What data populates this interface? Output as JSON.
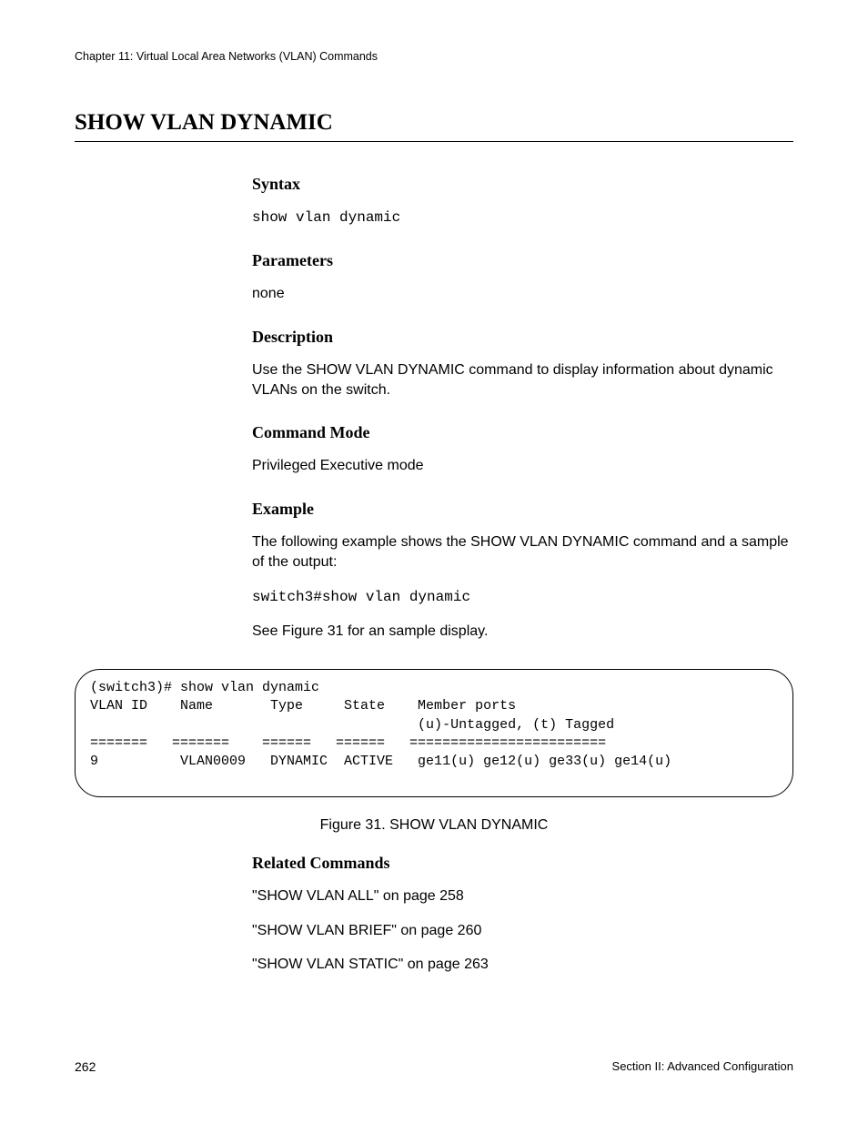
{
  "header": {
    "chapter": "Chapter 11: Virtual Local Area Networks (VLAN) Commands"
  },
  "title": "SHOW VLAN DYNAMIC",
  "sections": {
    "syntax": {
      "label": "Syntax",
      "command": "show vlan dynamic"
    },
    "parameters": {
      "label": "Parameters",
      "text": "none"
    },
    "description": {
      "label": "Description",
      "text": "Use the SHOW VLAN DYNAMIC command to display information about dynamic VLANs on the switch."
    },
    "command_mode": {
      "label": "Command Mode",
      "text": "Privileged Executive mode"
    },
    "example": {
      "label": "Example",
      "intro": "The following example shows the SHOW VLAN DYNAMIC command and a sample of the output:",
      "command_line": "switch3#show vlan dynamic",
      "see_text": "See Figure 31 for an sample display."
    },
    "related": {
      "label": "Related Commands",
      "items": [
        "\"SHOW VLAN ALL\" on page 258",
        "\"SHOW VLAN BRIEF\" on page 260",
        "\"SHOW VLAN STATIC\" on page 263"
      ]
    }
  },
  "figure": {
    "output": "(switch3)# show vlan dynamic\nVLAN ID    Name       Type     State    Member ports\n                                        (u)-Untagged, (t) Tagged\n=======   =======    ======   ======   ========================\n9          VLAN0009   DYNAMIC  ACTIVE   ge11(u) ge12(u) ge33(u) ge14(u)",
    "caption": "Figure 31. SHOW VLAN DYNAMIC"
  },
  "footer": {
    "page": "262",
    "section": "Section II: Advanced Configuration"
  }
}
